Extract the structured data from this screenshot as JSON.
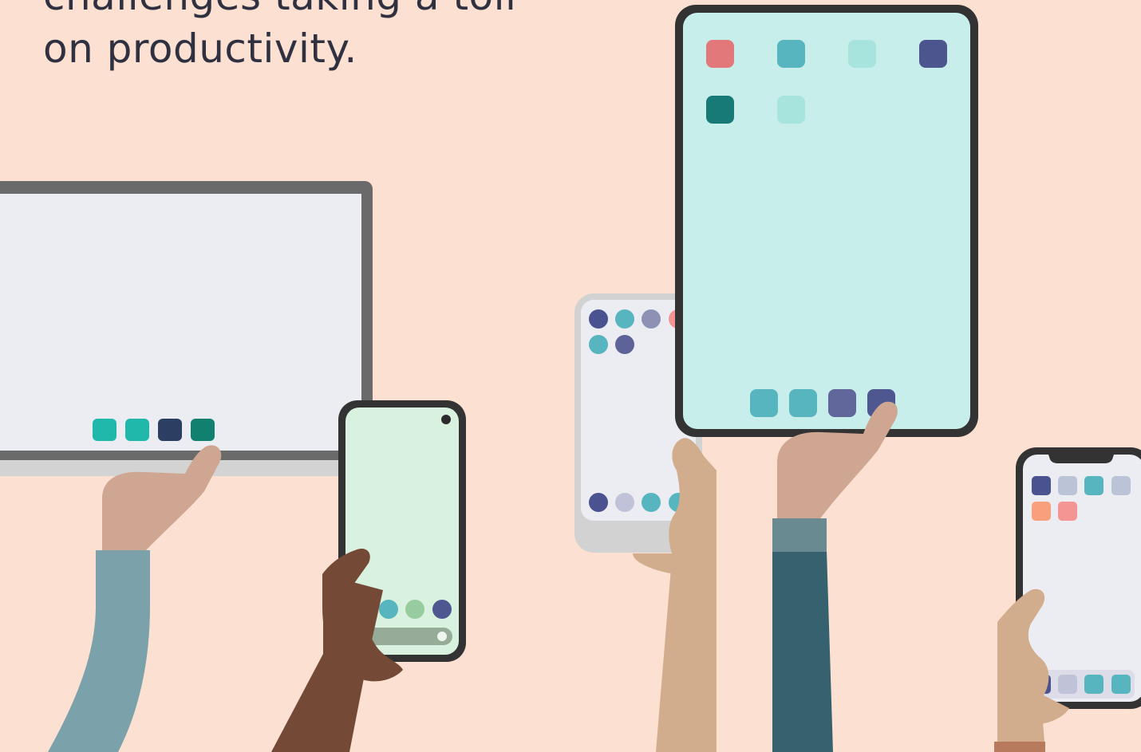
{
  "heading": {
    "line1": "challenges taking a toll",
    "line2": "on productivity."
  },
  "colors": {
    "background": "#fce0d2",
    "heading_text": "#2f3140",
    "monitor_frame": "#6a6a6a",
    "monitor_screen": "#ecedf2",
    "tablet_frame": "#333333",
    "tablet_screen": "#c8eeec",
    "phone_green_screen": "#d8f2df",
    "phone_light_screen": "#ecedf2"
  },
  "devices": {
    "monitor": {
      "dock_icon_colors": [
        "#1fb8aa",
        "#1fb8aa",
        "#2c3f63",
        "#11806f"
      ]
    },
    "tablet": {
      "app_icon_colors": [
        "#e2787a",
        "#56b5be",
        "#a7e4dd",
        "#4d558e",
        "#177a76",
        "#a7e4dd"
      ],
      "dock_icon_colors": [
        "#56b5be",
        "#56b5be",
        "#61679b",
        "#4f5790"
      ]
    },
    "phone_green": {
      "dock_icon_colors": [
        "#56b5be",
        "#56b5be",
        "#97cc9f",
        "#4f5790"
      ],
      "search_bar_color": "#97ab99"
    },
    "phone_silver": {
      "app_icon_colors": [
        "#4a5290",
        "#56b5be",
        "#8d91b6",
        "#f59593",
        "#56b5be",
        "#5d6299"
      ],
      "dock_icon_colors": [
        "#4a5290",
        "#c0c3d8",
        "#56b5be",
        "#56b5be"
      ]
    },
    "phone_notch": {
      "app_icon_colors": [
        "#4a5290",
        "#bbc4d6",
        "#56b5be",
        "#bbc4d6",
        "#fa9f7c",
        "#f59593"
      ],
      "dock_icon_colors": [
        "#4a5290",
        "#c0c3d8",
        "#56b5be",
        "#56b5be"
      ]
    }
  },
  "people": {
    "monitor_holder": {
      "skin": "#cfa692",
      "sleeve": "#7ba2ab"
    },
    "green_phone_holder": {
      "skin": "#744a36"
    },
    "silver_phone_holder": {
      "skin": "#d1ac8d"
    },
    "tablet_holder": {
      "skin": "#cfa692",
      "sleeve": "#366270",
      "cuff": "#6a8a92"
    },
    "notch_phone_holder": {
      "skin": "#d1ac8d",
      "sleeve": "#b87a5c"
    }
  }
}
